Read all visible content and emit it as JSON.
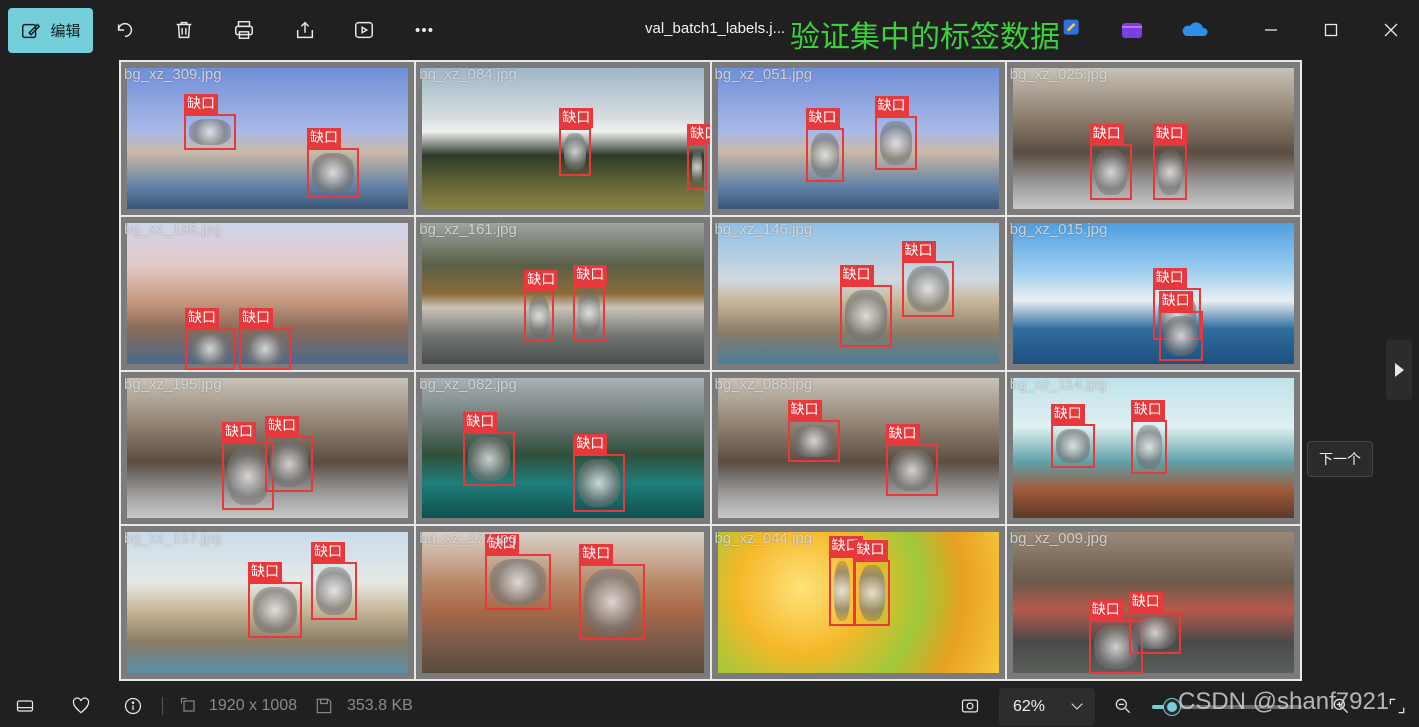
{
  "toolbar": {
    "edit_label": "编辑",
    "filename": "val_batch1_labels.j...",
    "overlay_title": "验证集中的标签数据",
    "icons": [
      "edit-icon",
      "rotate-icon",
      "delete-icon",
      "print-icon",
      "share-icon",
      "slideshow-icon",
      "more-icon"
    ]
  },
  "window_controls": [
    "minimize-icon",
    "maximize-icon",
    "close-icon"
  ],
  "tiles": [
    {
      "name": "bg_xz_309.jpg",
      "bg": "linear-gradient(180deg,#6f8fd8 0%,#a9b9e6 45%,#c9b9a5 60%,#5f7fa5 85%,#3a5677 100%)",
      "boxes": [
        {
          "label": "缺口"
        },
        {
          "label": "缺口"
        }
      ]
    },
    {
      "name": "bg_xz_084.jpg",
      "bg": "linear-gradient(180deg,#9fb6c6 0%,#d6dde0 35%,#f0f0ef 45%,#2c3b2a 62%,#6b6a3a 85%,#8a8347 100%)",
      "boxes": [
        {
          "label": "缺口"
        },
        {
          "label": "缺口"
        }
      ]
    },
    {
      "name": "bg_xz_051.jpg",
      "bg": "linear-gradient(180deg,#6f8fd8 0%,#a9b9e6 45%,#c9b9a5 60%,#5f7fa5 85%,#3a5677 100%)",
      "boxes": [
        {
          "label": "缺口"
        },
        {
          "label": "缺口"
        }
      ]
    },
    {
      "name": "bg_xz_025.jpg",
      "bg": "linear-gradient(180deg,#c8c2b8 0%,#8d7e6d 35%,#5b4d42 60%,#9a9a9a 82%,#c9c9c9 100%)",
      "boxes": [
        {
          "label": "缺口"
        },
        {
          "label": "缺口"
        }
      ]
    },
    {
      "name": "bg_xz_198.jpg",
      "bg": "linear-gradient(180deg,#cfd6ea 0%,#e3c9c9 30%,#c79a80 55%,#8a6a5a 75%,#4b6a8a 100%)",
      "boxes": [
        {
          "label": "缺口"
        },
        {
          "label": "缺口"
        }
      ]
    },
    {
      "name": "bg_xz_161.jpg",
      "bg": "linear-gradient(180deg,#9ea5a2 0%,#5a5f48 30%,#8b6a3a 50%,#c9c4b8 60%,#6f7470 80%,#4a4f4b 100%)",
      "boxes": [
        {
          "label": "缺口"
        },
        {
          "label": "缺口"
        }
      ]
    },
    {
      "name": "bg_xz_146.jpg",
      "bg": "linear-gradient(180deg,#8fc0e6 0%,#cfd9df 40%,#c9b89a 55%,#8a7b66 78%,#4a7f9a 100%)",
      "boxes": [
        {
          "label": "缺口"
        },
        {
          "label": "缺口"
        }
      ]
    },
    {
      "name": "bg_xz_015.jpg",
      "bg": "linear-gradient(180deg,#4f9fe0 0%,#9fcff0 35%,#eaeef2 55%,#2f6f9f 75%,#1f4f7f 100%)",
      "boxes": [
        {
          "label": "缺口"
        },
        {
          "label": "缺口"
        }
      ]
    },
    {
      "name": "bg_xz_195.jpg",
      "bg": "linear-gradient(180deg,#c8c2b8 0%,#8d7e6d 35%,#5b4d42 60%,#9a9a9a 82%,#c9c9c9 100%)",
      "boxes": [
        {
          "label": "缺口"
        },
        {
          "label": "缺口"
        }
      ]
    },
    {
      "name": "bg_xz_082.jpg",
      "bg": "linear-gradient(180deg,#aab3b8 0%,#6e7a78 30%,#2f4f3a 55%,#1f7f7a 75%,#0f4f4f 100%)",
      "boxes": [
        {
          "label": "缺口"
        },
        {
          "label": "缺口"
        }
      ]
    },
    {
      "name": "bg_xz_088.jpg",
      "bg": "linear-gradient(180deg,#c8c2b8 0%,#8d7e6d 35%,#5b4d42 60%,#9a9a9a 82%,#c9c9c9 100%)",
      "boxes": [
        {
          "label": "缺口"
        },
        {
          "label": "缺口"
        }
      ]
    },
    {
      "name": "bg_xz_114.jpg",
      "bg": "linear-gradient(180deg,#bfe2ea 0%,#dff0f2 35%,#5fa0a8 60%,#a15a3a 80%,#5a3a2a 100%)",
      "boxes": [
        {
          "label": "缺口"
        },
        {
          "label": "缺口"
        }
      ]
    },
    {
      "name": "bg_xz_157.jpg",
      "bg": "linear-gradient(180deg,#c9dcea 0%,#e6e9e6 35%,#c9b89a 55%,#8a7b66 78%,#5a8fa8 100%)",
      "boxes": [
        {
          "label": "缺口"
        },
        {
          "label": "缺口"
        }
      ]
    },
    {
      "name": "bg_xz_177.jpg",
      "bg": "linear-gradient(180deg,#d9d1c8 0%,#b98a6a 35%,#a86a4a 55%,#7a5a4a 80%,#5a4a3a 100%)",
      "boxes": [
        {
          "label": "缺口"
        },
        {
          "label": "缺口"
        }
      ]
    },
    {
      "name": "bg_xz_044.jpg",
      "bg": "radial-gradient(circle at 30% 40%,#ffe27a 0%,#f5b82a 30%,#9fc93a 55%,#e8a020 75%,#f7c840 100%)",
      "boxes": [
        {
          "label": "缺口"
        },
        {
          "label": "缺口"
        }
      ]
    },
    {
      "name": "bg_xz_009.jpg",
      "bg": "linear-gradient(180deg,#9a8a7a 0%,#6a5a4a 35%,#b45a4a 55%,#4a4a4a 78%,#5a5f5a 100%)",
      "boxes": [
        {
          "label": "缺口"
        },
        {
          "label": "缺口"
        }
      ]
    }
  ],
  "next_tooltip": "下一个",
  "status": {
    "dimensions": "1920 x 1008",
    "file_size": "353.8 KB",
    "zoom_value": "62%",
    "zoom_level": 0.13
  },
  "watermark": "CSDN @shanf7921"
}
